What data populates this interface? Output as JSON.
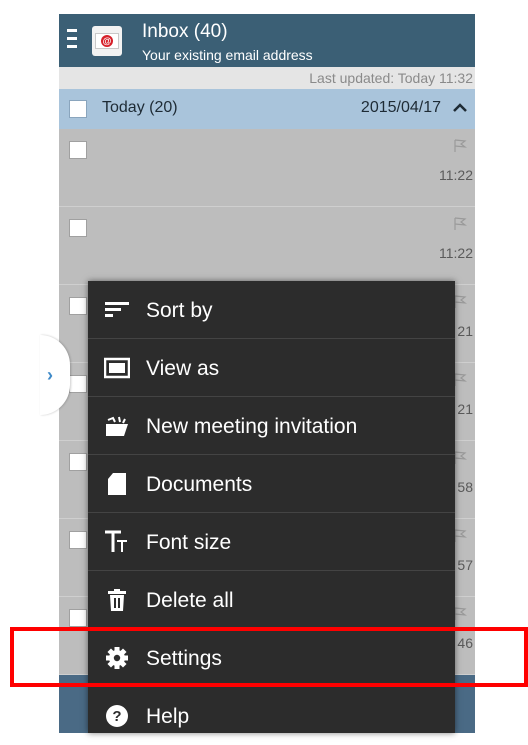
{
  "header": {
    "title": "Inbox (40)",
    "subtitle": "Your existing email address",
    "icons": [
      "hamburger-menu-icon",
      "email-app-icon"
    ]
  },
  "last_updated": "Last updated: Today 11:32",
  "group": {
    "label": "Today (20)",
    "date": "2015/04/17"
  },
  "mail_rows": [
    {
      "time": "11:22"
    },
    {
      "time": "11:22"
    },
    {
      "time": "21"
    },
    {
      "time": "21"
    },
    {
      "time": "58"
    },
    {
      "time": "57"
    },
    {
      "time": "46"
    }
  ],
  "menu": {
    "items": [
      {
        "label": "Sort by",
        "icon": "sort-icon"
      },
      {
        "label": "View as",
        "icon": "view-as-icon"
      },
      {
        "label": "New meeting invitation",
        "icon": "meeting-invitation-icon"
      },
      {
        "label": "Documents",
        "icon": "document-icon"
      },
      {
        "label": "Font size",
        "icon": "font-size-icon"
      },
      {
        "label": "Delete all",
        "icon": "trash-icon"
      },
      {
        "label": "Settings",
        "icon": "gear-icon"
      },
      {
        "label": "Help",
        "icon": "help-icon"
      }
    ]
  },
  "highlight_color": "#ff0000",
  "header_color": "#3b5f75"
}
